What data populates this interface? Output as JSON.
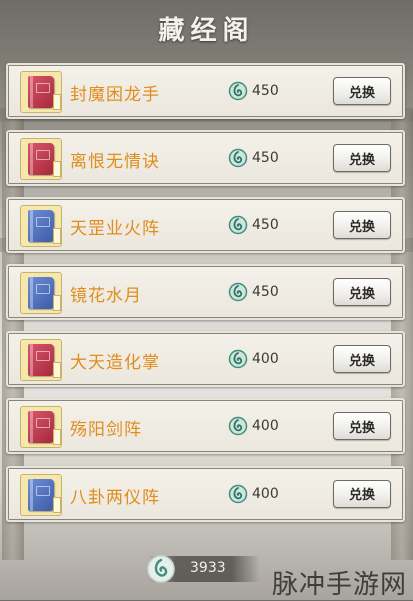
{
  "header": {
    "title": "藏经阁"
  },
  "items": [
    {
      "name": "封魔困龙手",
      "cost": "450",
      "book_color": "red",
      "button_label": "兑换"
    },
    {
      "name": "离恨无情诀",
      "cost": "450",
      "book_color": "red",
      "button_label": "兑换"
    },
    {
      "name": "天罡业火阵",
      "cost": "450",
      "book_color": "blue",
      "button_label": "兑换"
    },
    {
      "name": "镜花水月",
      "cost": "450",
      "book_color": "blue",
      "button_label": "兑换"
    },
    {
      "name": "大天造化掌",
      "cost": "400",
      "book_color": "red",
      "button_label": "兑换"
    },
    {
      "name": "殇阳剑阵",
      "cost": "400",
      "book_color": "red",
      "button_label": "兑换"
    },
    {
      "name": "八卦两仪阵",
      "cost": "400",
      "book_color": "blue",
      "button_label": "兑换"
    }
  ],
  "footer": {
    "total_currency": "3933",
    "watermark": "脉冲手游网"
  },
  "colors": {
    "item_name": "#e08d1e",
    "book_red": "#c23c50",
    "book_blue": "#5574c1",
    "currency_icon": "#3f8f7f"
  },
  "icons": {
    "currency": "jade-swirl-icon",
    "book": "book-icon"
  }
}
